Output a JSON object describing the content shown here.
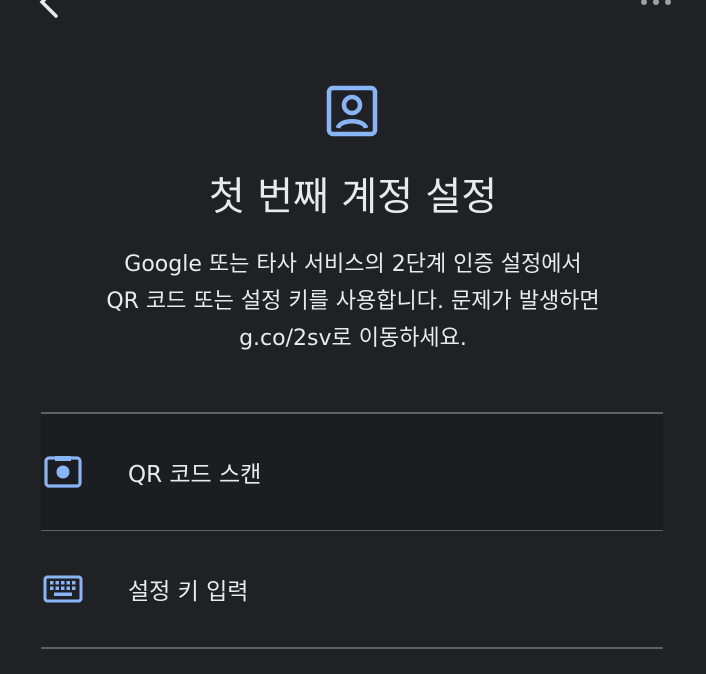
{
  "colors": {
    "background": "#202124",
    "accent": "#8ab4f8",
    "text": "#e8eaed",
    "divider": "#5f6368"
  },
  "header": {
    "back_icon": "chevron-left-icon",
    "more_icon": "more-vert-icon"
  },
  "hero": {
    "icon": "account-box-icon",
    "title": "첫 번째 계정 설정",
    "description_lines": [
      "Google 또는 타사 서비스의 2단계 인증 설정에서",
      "QR 코드 또는 설정 키를 사용합니다. 문제가 발생하면",
      "g.co/2sv로 이동하세요."
    ]
  },
  "options": [
    {
      "icon": "camera-icon",
      "label": "QR 코드 스캔"
    },
    {
      "icon": "keyboard-icon",
      "label": "설정 키 입력"
    }
  ]
}
